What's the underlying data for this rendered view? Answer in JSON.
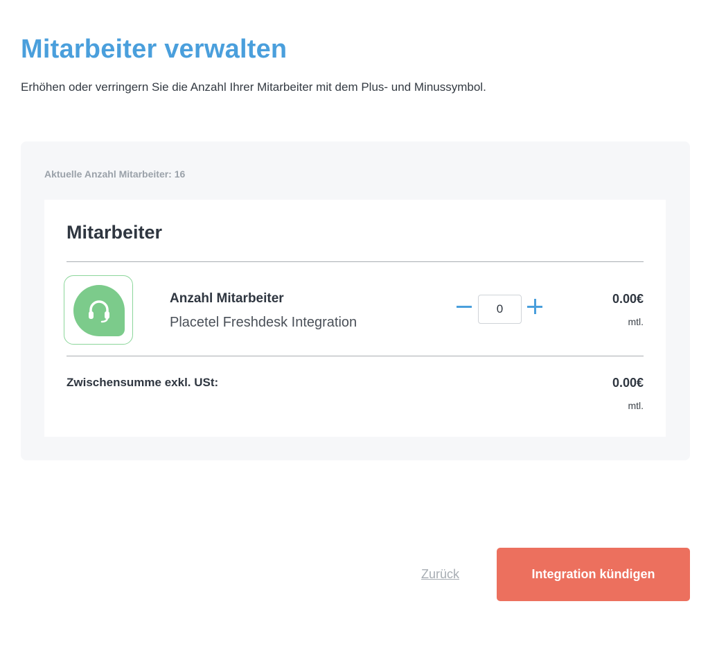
{
  "header": {
    "title": "Mitarbeiter verwalten",
    "subtitle": "Erhöhen oder verringern Sie die Anzahl Ihrer Mitarbeiter mit dem Plus- und Minussymbol."
  },
  "panel": {
    "current_count": "Aktuelle Anzahl Mitarbeiter: 16"
  },
  "card": {
    "title": "Mitarbeiter",
    "item": {
      "icon": "headset-icon",
      "name": "Anzahl Mitarbeiter",
      "description": "Placetel Freshdesk Integration",
      "quantity": "0",
      "price": "0.00€",
      "period": "mtl."
    },
    "subtotal": {
      "label": "Zwischensumme exkl. USt:",
      "price": "0.00€",
      "period": "mtl."
    }
  },
  "footer": {
    "back_label": "Zurück",
    "cancel_label": "Integration kündigen"
  },
  "colors": {
    "title": "#4a9fdc",
    "accent": "#4a9fdc",
    "icon_green": "#7ccb8b",
    "danger_button": "#ec705e",
    "panel_bg": "#f6f7f9"
  }
}
